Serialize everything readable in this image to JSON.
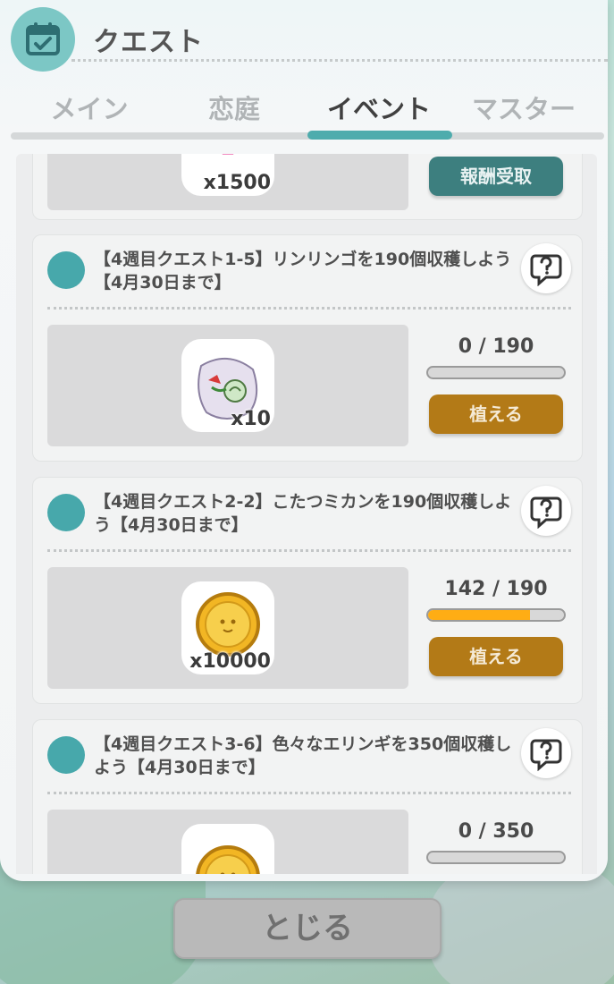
{
  "header": {
    "title": "クエスト",
    "icon": "calendar-icon"
  },
  "tabs": [
    {
      "label": "メイン"
    },
    {
      "label": "恋庭"
    },
    {
      "label": "イベント",
      "active": true
    },
    {
      "label": "マスター"
    }
  ],
  "partial_card": {
    "item_qty": "x1500",
    "button_label": "報酬受取"
  },
  "quests": [
    {
      "title": "【4週目クエスト1-5】リンリンゴを190個収穫しよう【4月30日まで】",
      "item_icon": "seed-bag-icon",
      "item_qty": "x10",
      "progress_text": "0 / 190",
      "progress": 0.0,
      "button_label": "植える"
    },
    {
      "title": "【4週目クエスト2-2】こたつミカンを190個収穫しよう【4月30日まで】",
      "item_icon": "gold-coin-icon",
      "item_qty": "x10000",
      "progress_text": "142 / 190",
      "progress": 0.747,
      "button_label": "植える"
    },
    {
      "title": "【4週目クエスト3-6】色々なエリンギを350個収穫しよう【4月30日まで】",
      "item_icon": "gold-coin-icon",
      "item_qty": "",
      "progress_text": "0 / 350",
      "progress": 0.0,
      "button_label": ""
    }
  ],
  "footer": {
    "close_label": "とじる"
  },
  "colors": {
    "accent": "#4eacad",
    "progress": "#ffad14",
    "action": "#b37a17"
  }
}
